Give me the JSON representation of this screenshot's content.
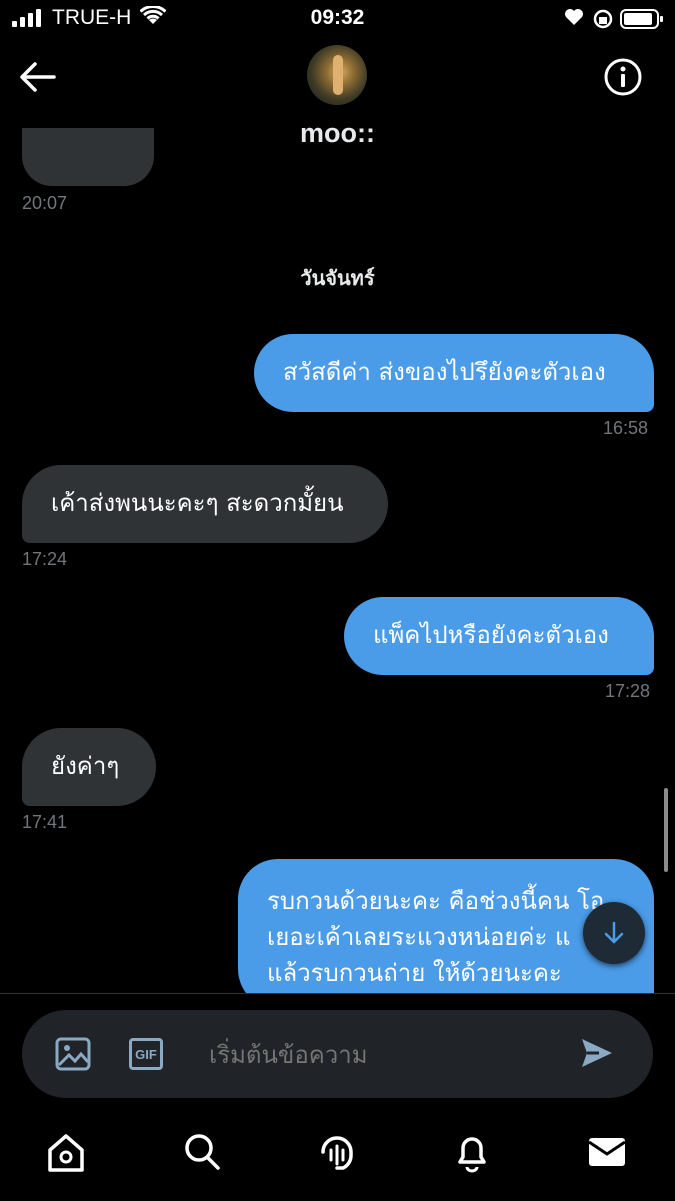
{
  "status_bar": {
    "carrier": "TRUE-H",
    "time": "09:32"
  },
  "header": {
    "title": "moo::"
  },
  "conversation": {
    "earlier_timestamp": "20:07",
    "day_label": "วันจันทร์",
    "messages": [
      {
        "direction": "out",
        "text": "สวัสดีค่า ส่งของไปรึยังคะตัวเอง",
        "time": "16:58"
      },
      {
        "direction": "in",
        "text": "เค้าส่งพนนะคะๆ สะดวกมั้ยน",
        "time": "17:24"
      },
      {
        "direction": "out",
        "text": "แพ็คไปหรือยังคะตัวเอง",
        "time": "17:28"
      },
      {
        "direction": "in",
        "text": "ยังค่าๆ",
        "time": "17:41"
      },
      {
        "direction": "out",
        "lines": [
          "รบกวนด้วยนะคะ คือช่วงนี้คน โอ",
          "เยอะเค้าเลยระแวงหน่อยค่ะ แ",
          "แล้วรบกวนถ่าย ให้ด้วยนะคะ"
        ]
      }
    ]
  },
  "composer": {
    "placeholder": "เริ่มต้นข้อความ",
    "gif_label": "GIF"
  },
  "colors": {
    "accent": "#4a9be8",
    "incoming_bubble": "#2f3336",
    "background": "#000000"
  },
  "tab_bar": {
    "items": [
      "home-icon",
      "search-icon",
      "spaces-icon",
      "notifications-icon",
      "messages-icon"
    ],
    "active": "messages-icon"
  }
}
